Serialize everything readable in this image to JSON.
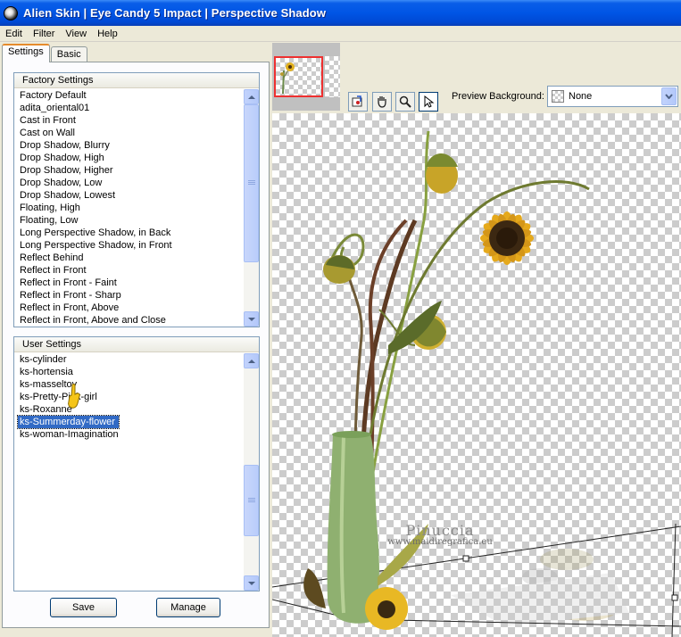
{
  "window": {
    "title": "Alien Skin  |  Eye Candy 5 Impact  |  Perspective Shadow"
  },
  "menu": [
    "Edit",
    "Filter",
    "View",
    "Help"
  ],
  "tabs": [
    "Settings",
    "Basic"
  ],
  "factory_settings": {
    "header": "Factory Settings",
    "items": [
      "Factory Default",
      "adita_oriental01",
      "Cast in Front",
      "Cast on Wall",
      "Drop Shadow, Blurry",
      "Drop Shadow, High",
      "Drop Shadow, Higher",
      "Drop Shadow, Low",
      "Drop Shadow, Lowest",
      "Floating, High",
      "Floating, Low",
      "Long Perspective Shadow, in Back",
      "Long Perspective Shadow, in Front",
      "Reflect Behind",
      "Reflect in Front",
      "Reflect in Front - Faint",
      "Reflect in Front - Sharp",
      "Reflect in Front, Above",
      "Reflect in Front, Above and Close"
    ]
  },
  "user_settings": {
    "header": "User Settings",
    "items": [
      "ks-cylinder",
      "ks-hortensia",
      "ks-masseltov",
      "ks-Pretty-Pink-girl",
      "ks-Roxanne",
      "ks-Summerday-flower",
      "ks-woman-Imagination"
    ],
    "selected_index": 5
  },
  "buttons": {
    "save": "Save",
    "manage": "Manage"
  },
  "preview_background": {
    "label": "Preview Background:",
    "value": "None"
  },
  "tools": [
    "hand-preview-icon",
    "hand-pan-icon",
    "zoom-icon",
    "pointer-icon"
  ],
  "watermark": {
    "title": "Pinuccia",
    "url": "www.maidiregrafica.eu"
  }
}
